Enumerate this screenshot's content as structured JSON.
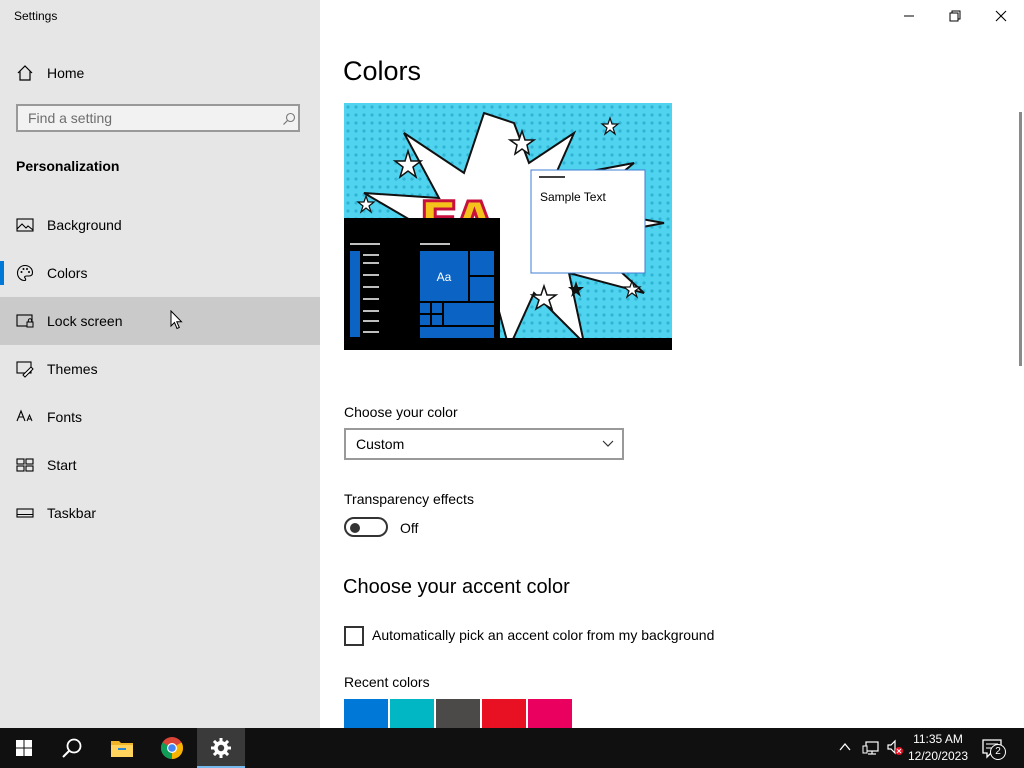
{
  "window": {
    "app_title": "Settings",
    "controls": {
      "minimize": "minimize",
      "restore": "restore",
      "close": "close"
    }
  },
  "sidebar": {
    "home_label": "Home",
    "search_placeholder": "Find a setting",
    "section_label": "Personalization",
    "accent_color": "#0078d7",
    "items": [
      {
        "label": "Background",
        "icon": "picture-icon",
        "selected": false,
        "hovered": false
      },
      {
        "label": "Colors",
        "icon": "palette-icon",
        "selected": true,
        "hovered": false
      },
      {
        "label": "Lock screen",
        "icon": "lock-screen-icon",
        "selected": false,
        "hovered": true
      },
      {
        "label": "Themes",
        "icon": "brush-icon",
        "selected": false,
        "hovered": false
      },
      {
        "label": "Fonts",
        "icon": "font-icon",
        "selected": false,
        "hovered": false
      },
      {
        "label": "Start",
        "icon": "start-icon",
        "selected": false,
        "hovered": false
      },
      {
        "label": "Taskbar",
        "icon": "taskbar-icon",
        "selected": false,
        "hovered": false
      }
    ]
  },
  "main": {
    "title": "Colors",
    "preview": {
      "sample_text": "Sample Text",
      "tile_label": "Aa"
    },
    "choose_color_label": "Choose your color",
    "choose_color_value": "Custom",
    "transparency_label": "Transparency effects",
    "transparency_state": "Off",
    "accent_heading": "Choose your accent color",
    "auto_accent_label": "Automatically pick an accent color from my background",
    "recent_colors_label": "Recent colors",
    "recent_colors": [
      "#0078d7",
      "#00b7c3",
      "#4c4a48",
      "#e81123",
      "#ea005e"
    ]
  },
  "taskbar": {
    "apps": [
      "start-icon",
      "search-icon",
      "file-explorer-icon",
      "chrome-icon",
      "settings-icon"
    ],
    "clock_time": "11:35 AM",
    "clock_date": "12/20/2023",
    "notification_count": "2"
  }
}
